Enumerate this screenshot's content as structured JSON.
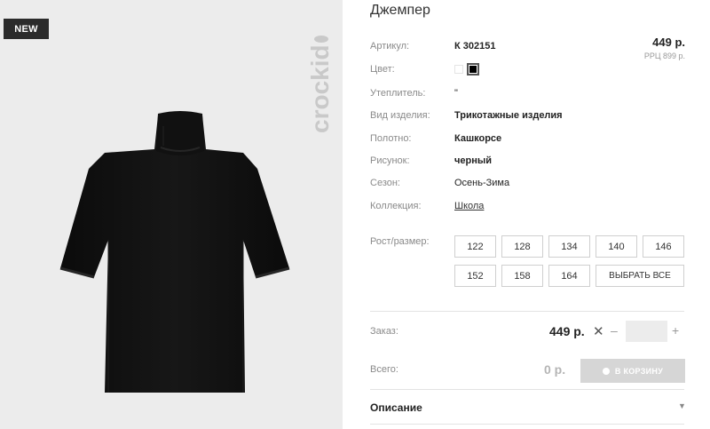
{
  "badge": "NEW",
  "brand": "crockid",
  "title": "Джемпер",
  "price": "449 р.",
  "rrp": "РРЦ 899 р.",
  "fields": {
    "article": {
      "label": "Артикул:",
      "value": "К 302151"
    },
    "color": {
      "label": "Цвет:"
    },
    "insulation": {
      "label": "Утеплитель:",
      "value": "\""
    },
    "type": {
      "label": "Вид изделия:",
      "value": "Трикотажные изделия"
    },
    "fabric": {
      "label": "Полотно:",
      "value": "Кашкорсе"
    },
    "pattern": {
      "label": "Рисунок:",
      "value": "черный"
    },
    "season": {
      "label": "Сезон:",
      "value": "Осень-Зима"
    },
    "collection": {
      "label": "Коллекция:",
      "value": "Школа"
    }
  },
  "colors": [
    "#ffffff",
    "#000000"
  ],
  "sizes_label": "Рост/размер:",
  "sizes": [
    "122",
    "128",
    "134",
    "140",
    "146",
    "152",
    "158",
    "164"
  ],
  "select_all": "ВЫБРАТЬ ВСЕ",
  "order": {
    "label": "Заказ:",
    "price": "449 р.",
    "times": "✕",
    "minus": "–",
    "plus": "+",
    "qty": ""
  },
  "total": {
    "label": "Всего:",
    "value": "0 р.",
    "cart_button": "В КОРЗИНУ"
  },
  "description": {
    "label": "Описание",
    "caret": "▼"
  },
  "icons": {
    "times": "times-icon",
    "caret": "chevron-down-icon",
    "cart": "cart-icon"
  }
}
